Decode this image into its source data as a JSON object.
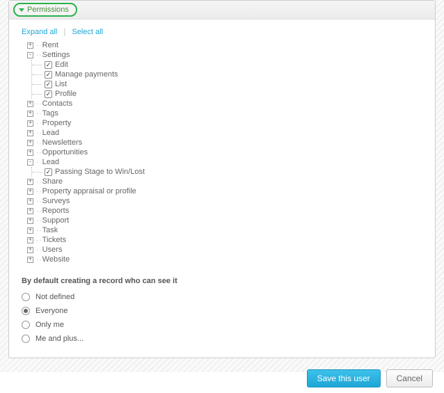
{
  "header": {
    "title": "Permissions"
  },
  "links": {
    "expand_all": "Expand all",
    "select_all": "Select all"
  },
  "tree": [
    {
      "label": "Rent",
      "expanded": false
    },
    {
      "label": "Settings",
      "expanded": true,
      "children": [
        {
          "label": "Edit",
          "checked": true
        },
        {
          "label": "Manage payments",
          "checked": true
        },
        {
          "label": "List",
          "checked": true
        },
        {
          "label": "Profile",
          "checked": true
        }
      ]
    },
    {
      "label": "Contacts",
      "expanded": false
    },
    {
      "label": "Tags",
      "expanded": false
    },
    {
      "label": "Property",
      "expanded": false
    },
    {
      "label": "Lead",
      "expanded": false
    },
    {
      "label": "Newsletters",
      "expanded": false
    },
    {
      "label": "Opportunities",
      "expanded": false
    },
    {
      "label": "Lead",
      "expanded": true,
      "children": [
        {
          "label": "Passing Stage to Win/Lost",
          "checked": true
        }
      ]
    },
    {
      "label": "Share",
      "expanded": false
    },
    {
      "label": "Property appraisal or profile",
      "expanded": false
    },
    {
      "label": "Surveys",
      "expanded": false
    },
    {
      "label": "Reports",
      "expanded": false
    },
    {
      "label": "Support",
      "expanded": false
    },
    {
      "label": "Task",
      "expanded": false
    },
    {
      "label": "Tickets",
      "expanded": false
    },
    {
      "label": "Users",
      "expanded": false
    },
    {
      "label": "Website",
      "expanded": false
    }
  ],
  "visibility": {
    "question": "By default creating a record who can see it",
    "options": [
      {
        "label": "Not defined",
        "selected": false
      },
      {
        "label": "Everyone",
        "selected": true
      },
      {
        "label": "Only me",
        "selected": false
      },
      {
        "label": "Me and plus...",
        "selected": false
      }
    ]
  },
  "footer": {
    "save": "Save this user",
    "cancel": "Cancel"
  }
}
